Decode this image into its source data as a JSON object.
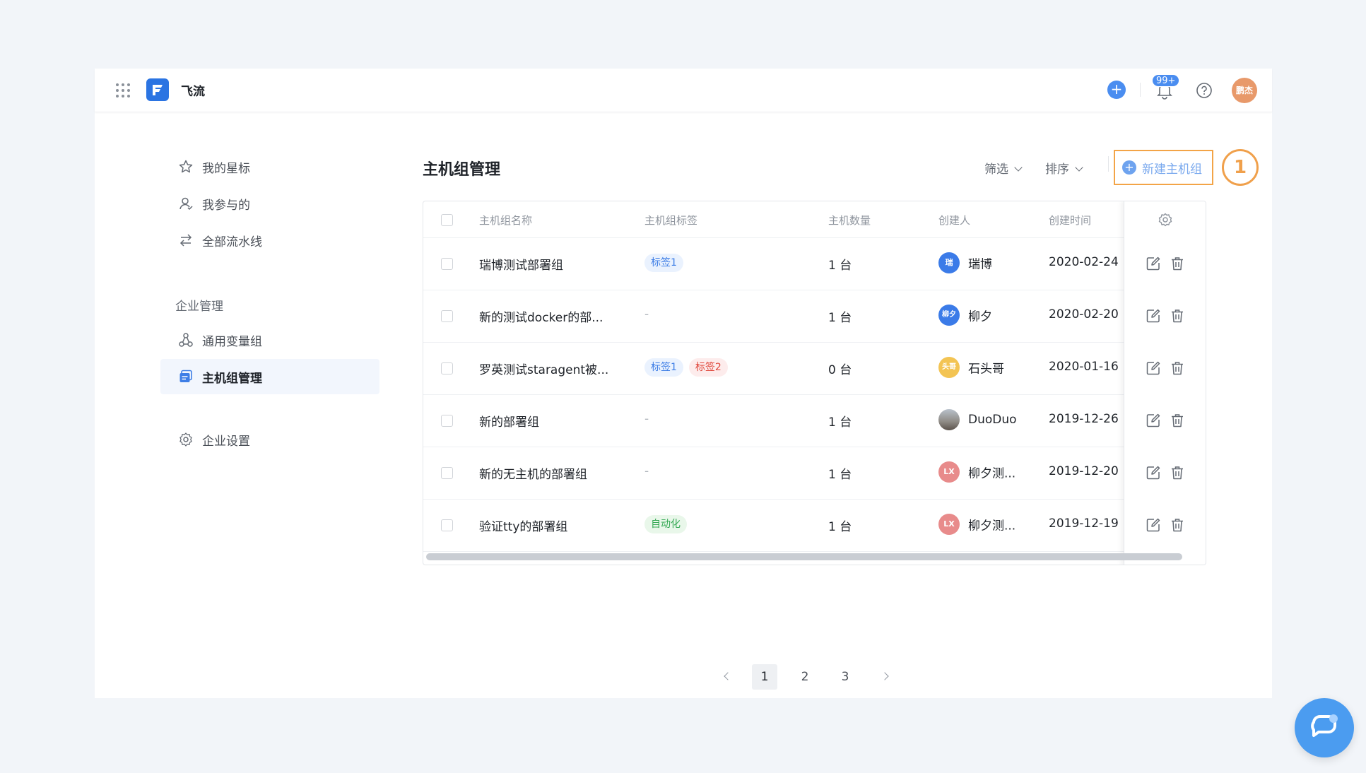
{
  "header": {
    "app_name": "飞流",
    "notification_badge": "99+",
    "avatar_text": "鹏杰"
  },
  "sidebar": {
    "items": [
      {
        "label": "我的星标",
        "icon": "star-icon"
      },
      {
        "label": "我参与的",
        "icon": "user-icon"
      },
      {
        "label": "全部流水线",
        "icon": "pipeline-icon"
      }
    ],
    "section_title": "企业管理",
    "enterprise_items": [
      {
        "label": "通用变量组",
        "icon": "variable-group-icon"
      },
      {
        "label": "主机组管理",
        "icon": "host-group-icon",
        "active": true
      }
    ],
    "settings_label": "企业设置"
  },
  "main": {
    "title": "主机组管理",
    "filter_label": "筛选",
    "sort_label": "排序",
    "new_button_label": "新建主机组",
    "step_number": "1"
  },
  "table": {
    "columns": [
      "主机组名称",
      "主机组标签",
      "主机数量",
      "创建人",
      "创建时间"
    ],
    "rows": [
      {
        "name": "瑞博测试部署组",
        "tags": [
          "标签1"
        ],
        "count": "1 台",
        "creator": "瑞博",
        "avatar": "瑞",
        "created": "2020-02-24"
      },
      {
        "name": "新的测试docker的部...",
        "tags": [],
        "count": "1 台",
        "creator": "柳夕",
        "avatar": "柳夕",
        "created": "2020-02-20"
      },
      {
        "name": "罗英测试staragent被...",
        "tags": [
          "标签1",
          "标签2"
        ],
        "count": "0 台",
        "creator": "石头哥",
        "avatar": "头哥",
        "created": "2020-01-16"
      },
      {
        "name": "新的部署组",
        "tags": [],
        "count": "1 台",
        "creator": "DuoDuo",
        "avatar": "",
        "created": "2019-12-26"
      },
      {
        "name": "新的无主机的部署组",
        "tags": [],
        "count": "1 台",
        "creator": "柳夕测...",
        "avatar": "LX",
        "created": "2019-12-20"
      },
      {
        "name": "验证tty的部署组",
        "tags": [
          "自动化"
        ],
        "count": "1 台",
        "creator": "柳夕测...",
        "avatar": "LX",
        "created": "2019-12-19"
      }
    ],
    "empty_tag": "-"
  },
  "pagination": {
    "pages": [
      "1",
      "2",
      "3"
    ],
    "current": "1"
  },
  "colors": {
    "accent": "#4a8df0",
    "highlight": "#f0a04b"
  }
}
